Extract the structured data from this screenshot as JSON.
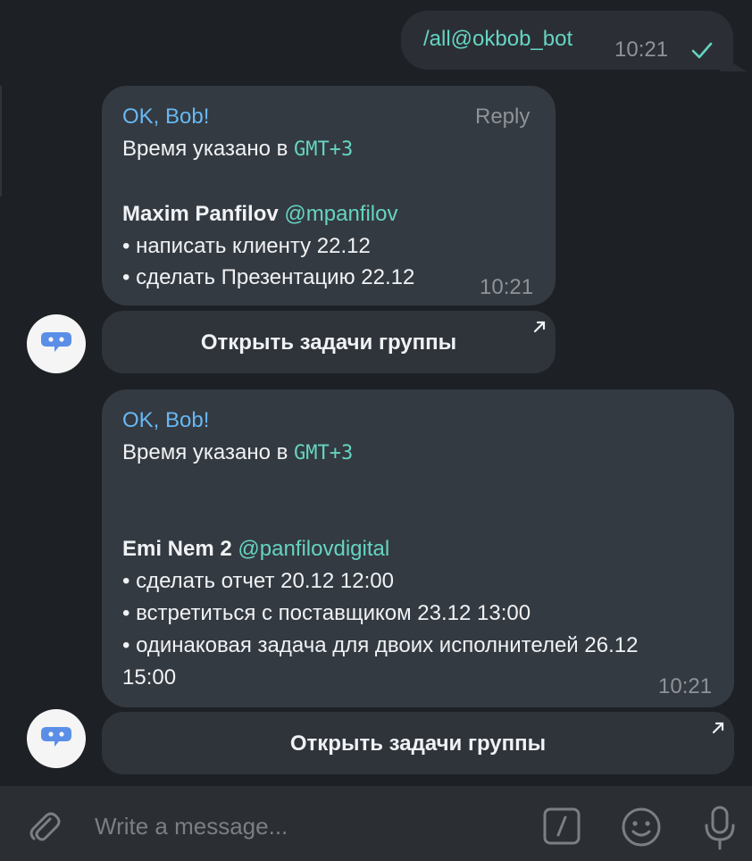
{
  "outgoing": {
    "text": "/all@okbob_bot",
    "time": "10:21",
    "status_icon": "check-icon"
  },
  "messages": [
    {
      "sender": "OK, Bob!",
      "reply_label": "Reply",
      "timezone_prefix": "Время указано в ",
      "timezone_value": "GMT+3",
      "assignee_name": "Maxim Panfilov",
      "assignee_handle": "@mpanfilov",
      "tasks": [
        "• написать клиенту 22.12",
        "• сделать  Презентацию 22.12"
      ],
      "time": "10:21",
      "button_label": "Открыть задачи группы"
    },
    {
      "sender": "OK, Bob!",
      "timezone_prefix": "Время указано в ",
      "timezone_value": "GMT+3",
      "assignee_name": "Emi Nem 2",
      "assignee_handle": "@panfilovdigital",
      "tasks": [
        "• сделать отчет 20.12 12:00",
        "• встретиться с поставщиком 23.12 13:00",
        "• одинаковая задача для двоих исполнителей 26.12",
        "15:00"
      ],
      "time": "10:21",
      "button_label": "Открыть задачи группы"
    }
  ],
  "composer": {
    "placeholder": "Write a message..."
  },
  "colors": {
    "background": "#1d2025",
    "bubble_in": "#343a41",
    "bubble_out": "#2b2f35",
    "accent_teal": "#65d4c2",
    "sender_blue": "#67b8f3",
    "muted": "#8f9398"
  }
}
